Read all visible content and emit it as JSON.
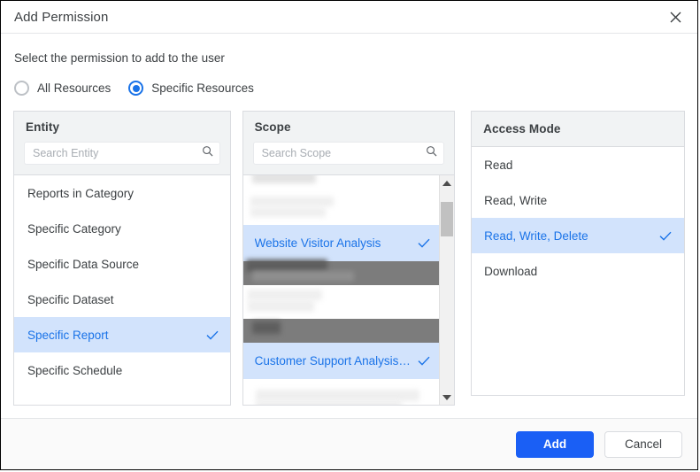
{
  "dialog": {
    "title": "Add Permission",
    "close_icon": "close-icon"
  },
  "instruction": "Select the permission to add to the user",
  "resource_scope": {
    "options": [
      {
        "label": "All Resources",
        "selected": false
      },
      {
        "label": "Specific Resources",
        "selected": true
      }
    ]
  },
  "entity_panel": {
    "title": "Entity",
    "search_placeholder": "Search Entity",
    "search_value": "",
    "search_icon": "search-icon",
    "items": [
      {
        "label": "Reports in Category",
        "selected": false
      },
      {
        "label": "Specific Category",
        "selected": false
      },
      {
        "label": "Specific Data Source",
        "selected": false
      },
      {
        "label": "Specific Dataset",
        "selected": false
      },
      {
        "label": "Specific Report",
        "selected": true
      },
      {
        "label": "Specific Schedule",
        "selected": false
      }
    ]
  },
  "scope_panel": {
    "title": "Scope",
    "search_placeholder": "Search Scope",
    "search_value": "",
    "search_icon": "search-icon",
    "items": [
      {
        "label": "",
        "selected": false,
        "redacted": "light-partial"
      },
      {
        "label": "",
        "selected": false,
        "redacted": "light"
      },
      {
        "label": "Website Visitor Analysis",
        "selected": true,
        "redacted": "none"
      },
      {
        "label": "",
        "selected": false,
        "redacted": "dark"
      },
      {
        "label": "",
        "selected": false,
        "redacted": "light"
      },
      {
        "label": "",
        "selected": false,
        "redacted": "dark"
      },
      {
        "label": "Customer Support Analysis…",
        "selected": true,
        "redacted": "none"
      },
      {
        "label": "",
        "selected": false,
        "redacted": "light-partial"
      }
    ],
    "scrollbar": {
      "up_icon": "scroll-up-arrow-icon",
      "down_icon": "scroll-down-arrow-icon"
    }
  },
  "access_panel": {
    "title": "Access Mode",
    "items": [
      {
        "label": "Read",
        "selected": false
      },
      {
        "label": "Read, Write",
        "selected": false
      },
      {
        "label": "Read, Write, Delete",
        "selected": true
      },
      {
        "label": "Download",
        "selected": false
      }
    ]
  },
  "footer": {
    "primary_label": "Add",
    "secondary_label": "Cancel"
  },
  "colors": {
    "accent": "#1a73e8",
    "selection_bg": "#d2e3fc",
    "primary_button": "#1a5ff5",
    "panel_header": "#f1f3f4",
    "border": "#dadce0"
  }
}
